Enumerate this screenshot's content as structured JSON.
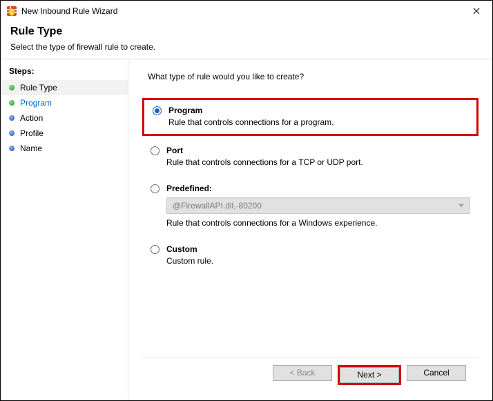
{
  "window": {
    "title": "New Inbound Rule Wizard"
  },
  "header": {
    "title": "Rule Type",
    "subtitle": "Select the type of firewall rule to create."
  },
  "sidebar": {
    "header": "Steps:",
    "items": [
      {
        "label": "Rule Type"
      },
      {
        "label": "Program"
      },
      {
        "label": "Action"
      },
      {
        "label": "Profile"
      },
      {
        "label": "Name"
      }
    ]
  },
  "main": {
    "prompt": "What type of rule would you like to create?",
    "options": {
      "program": {
        "title": "Program",
        "desc": "Rule that controls connections for a program."
      },
      "port": {
        "title": "Port",
        "desc": "Rule that controls connections for a TCP or UDP port."
      },
      "predefined": {
        "title": "Predefined:",
        "select_value": "@FirewallAPI.dll,-80200",
        "desc": "Rule that controls connections for a Windows experience."
      },
      "custom": {
        "title": "Custom",
        "desc": "Custom rule."
      }
    }
  },
  "footer": {
    "back": "< Back",
    "next": "Next >",
    "cancel": "Cancel"
  }
}
